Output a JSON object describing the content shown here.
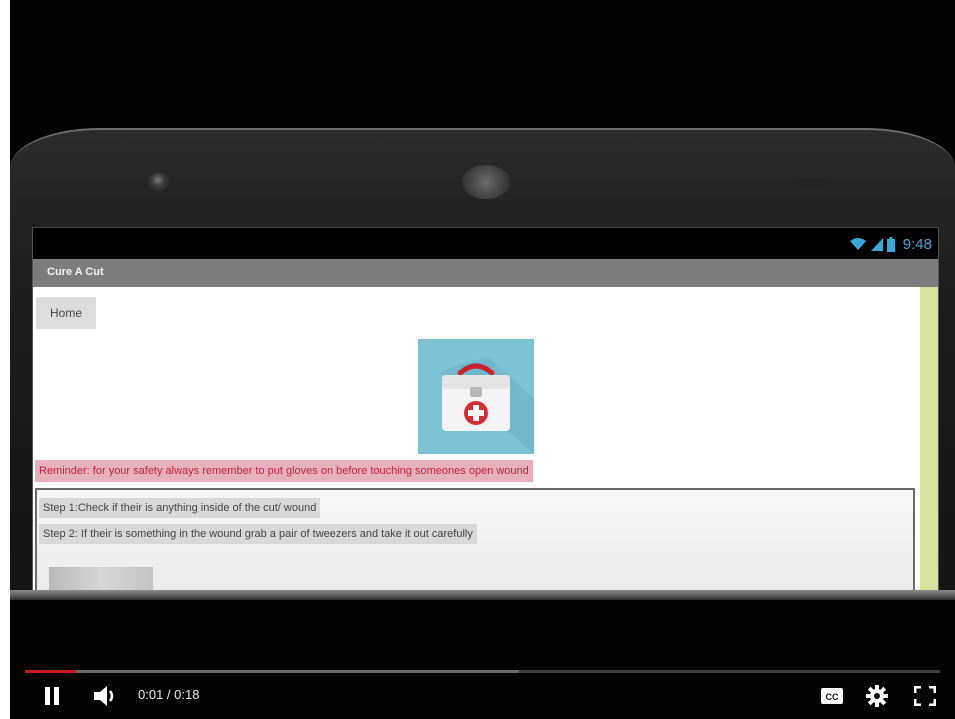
{
  "phone_screen": {
    "status_time": "9:48",
    "app_title": "Cure A Cut",
    "home_button": "Home",
    "reminder": "Reminder: for your safety always remember to put gloves on before touching someones open wound",
    "steps": [
      "Step 1:Check if their is anything inside of the cut/ wound",
      "Step 2: If their is something in the wound grab a pair of tweezers and take it out carefully"
    ]
  },
  "player": {
    "current_time": "0:01",
    "duration": "0:18",
    "time_label": "0:01 / 0:18",
    "played_fraction": 0.056,
    "buffered_fraction": 0.54,
    "icons": {
      "play_pause": "pause-icon",
      "volume": "volume-icon",
      "captions": "cc-icon",
      "settings": "gear-icon",
      "fullscreen": "fullscreen-icon"
    }
  },
  "colors": {
    "progress_played": "#cc181e",
    "status_time": "#3aa8d8",
    "reminder_text": "#c2233f",
    "reminder_bg": "#e7b0bd",
    "kit_bg": "#7cc3d3"
  }
}
